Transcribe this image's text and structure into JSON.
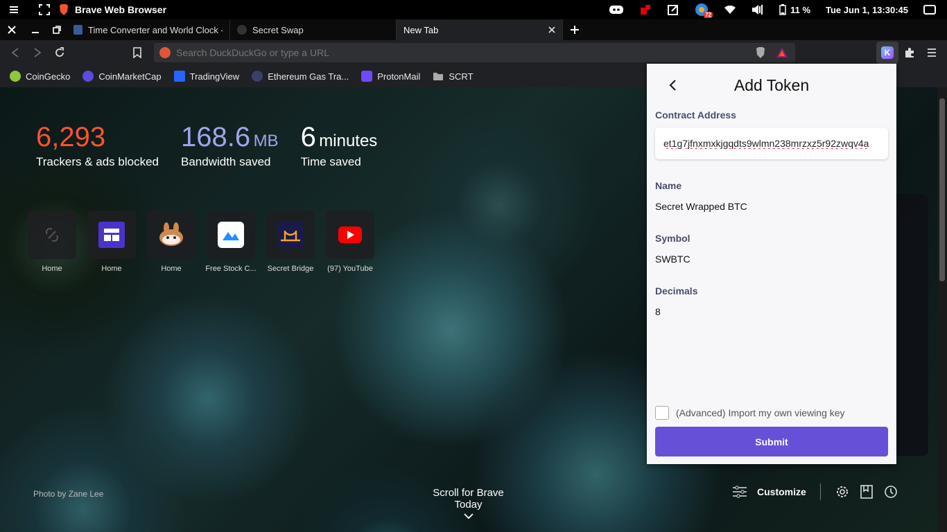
{
  "os": {
    "app_title": "Brave Web Browser",
    "battery": "11 %",
    "clock": "Tue Jun  1, 13:30:45",
    "notification_count": "72"
  },
  "tabs": [
    {
      "label": "Time Converter and World Clock - C"
    },
    {
      "label": "Secret Swap"
    },
    {
      "label": "New Tab"
    }
  ],
  "omnibox": {
    "placeholder": "Search DuckDuckGo or type a URL"
  },
  "bookmarks": [
    {
      "label": "CoinGecko",
      "color": "#8dc63f"
    },
    {
      "label": "CoinMarketCap",
      "color": "#5b4be0"
    },
    {
      "label": "TradingView",
      "color": "#2962ff"
    },
    {
      "label": "Ethereum Gas Tra...",
      "color": "#3b3f6b"
    },
    {
      "label": "ProtonMail",
      "color": "#6d4aff"
    },
    {
      "label": "SCRT",
      "color": "#aaaaaa"
    }
  ],
  "stats": [
    {
      "number": "6,293",
      "unit": "",
      "label": "Trackers & ads blocked",
      "color": "#fb542b"
    },
    {
      "number": "168.6",
      "unit": "MB",
      "label": "Bandwidth saved",
      "color": "#a0a5eb"
    },
    {
      "number": "6",
      "unit": "minutes",
      "label": "Time saved",
      "color": "#ffffff"
    }
  ],
  "top_sites": [
    {
      "label": "Home"
    },
    {
      "label": "Home"
    },
    {
      "label": "Home"
    },
    {
      "label": "Free Stock C..."
    },
    {
      "label": "Secret Bridge"
    },
    {
      "label": "(97) YouTube"
    }
  ],
  "footer": {
    "photo_credit": "Photo by Zane Lee",
    "scroll_today": "Scroll for Brave Today",
    "customize": "Customize"
  },
  "popup": {
    "title": "Add Token",
    "contract_label": "Contract Address",
    "contract_value": "et1g7jfnxmxkjgqdts9wlmn238mrzxz5r92zwqv4a",
    "name_label": "Name",
    "name_value": "Secret Wrapped BTC",
    "symbol_label": "Symbol",
    "symbol_value": "SWBTC",
    "decimals_label": "Decimals",
    "decimals_value": "8",
    "advanced_label": "(Advanced) Import my own viewing key",
    "submit_label": "Submit",
    "accent": "#6750d8"
  }
}
